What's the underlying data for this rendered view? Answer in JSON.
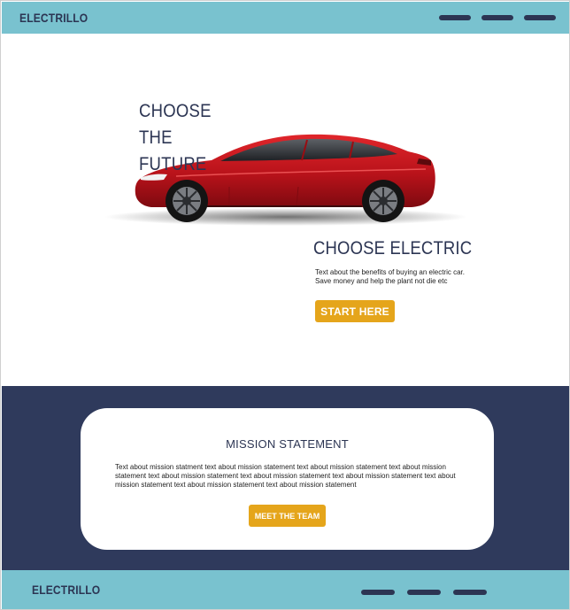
{
  "colors": {
    "header_bg": "#79c2cf",
    "navy": "#2c3553",
    "mission_bg": "#2f3a5c",
    "accent": "#e5a51b",
    "car_red": "#c4141a"
  },
  "header": {
    "logo": "ELECTRILLO",
    "menu_icon": "menu-bars-icon"
  },
  "hero": {
    "title": "CHOOSE THE FUTURE",
    "subtitle": "CHOOSE ELECTRIC",
    "body": "Text about the benefits of buying an electric car. Save money and help the plant not die etc",
    "cta_label": "START HERE",
    "image": "red-electric-car"
  },
  "mission": {
    "title": "MISSION STATEMENT",
    "body": "Text about mission statment text about mission statement  text about mission statement  text about mission statement text about mission statement text about mission statement text about mission statement text about mission statement text about mission statement text about mission statement",
    "button_label": "MEET THE TEAM"
  },
  "footer": {
    "logo": "ELECTRILLO",
    "menu_icon": "menu-bars-icon"
  }
}
